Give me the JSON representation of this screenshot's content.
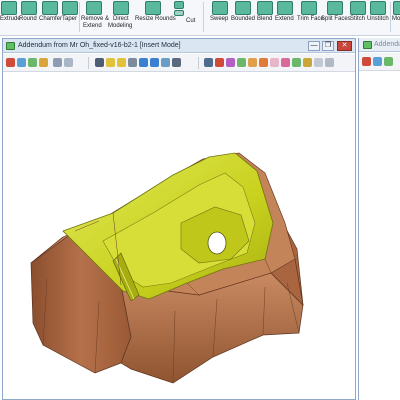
{
  "ribbon": {
    "buttons": [
      {
        "label": "Extrude",
        "icon": "extrude-icon"
      },
      {
        "label": "Round",
        "icon": "round-icon"
      },
      {
        "label": "Chamfer",
        "icon": "chamfer-icon"
      },
      {
        "label": "Taper",
        "icon": "taper-icon"
      },
      {
        "label": "Remove &",
        "label2": "Extend",
        "icon": "remove-extend-icon"
      },
      {
        "label": "Direct",
        "label2": "Modeling",
        "icon": "direct-modeling-icon"
      },
      {
        "label": "Resize Rounds",
        "icon": "resize-rounds-icon"
      },
      {
        "label": "Cut",
        "icon": "cut-icon"
      },
      {
        "label": "Sweep",
        "icon": "sweep-icon"
      },
      {
        "label": "Bounded",
        "icon": "bounded-icon"
      },
      {
        "label": "Blend",
        "icon": "blend-icon"
      },
      {
        "label": "Extend",
        "icon": "extend-icon"
      },
      {
        "label": "Trim Face",
        "icon": "trim-face-icon"
      },
      {
        "label": "Split Faces",
        "icon": "split-faces-icon"
      },
      {
        "label": "Stitch",
        "icon": "stitch-icon"
      },
      {
        "label": "Unstitch",
        "icon": "unstitch-icon"
      },
      {
        "label": "Mo",
        "icon": "more-icon"
      }
    ],
    "accent": "#59b99a"
  },
  "main_window": {
    "title": "Addendum from Mr Oh_fixed-v16-b2-1 [Insert Mode]",
    "minimize": "—",
    "restore": "❐",
    "close": "✕"
  },
  "second_window": {
    "title": "Addendum"
  },
  "model": {
    "body_color": "#b5714a",
    "addendum_color": "#c9d21e"
  }
}
